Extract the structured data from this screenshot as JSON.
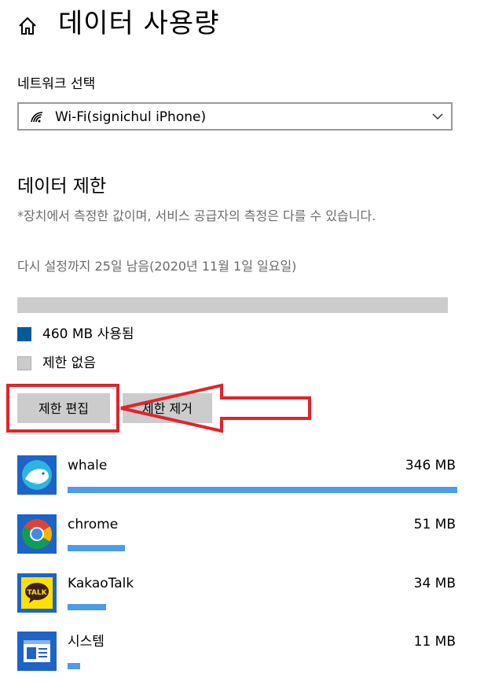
{
  "header": {
    "title": "데이터 사용량",
    "home_icon": "home-icon"
  },
  "network": {
    "label": "네트워크 선택",
    "selected": "Wi-Fi(signichul iPhone)",
    "icon": "wifi-icon"
  },
  "data_limit": {
    "title": "데이터 제한",
    "note": "*장치에서 측정한 값이며, 서비스 공급자의 측정은 다를 수 있습니다.",
    "reset_text": "다시 설정까지 25일 남음(2020년 11월 1일 일요일)",
    "used_fraction": 0.0,
    "legend": [
      {
        "label": "460 MB 사용됨",
        "color": "#005a9e"
      },
      {
        "label": "제한 없음",
        "color": "#cccccc"
      }
    ]
  },
  "buttons": {
    "edit_limit": "제한 편집",
    "remove_limit": "제한 제거"
  },
  "apps": [
    {
      "name": "whale",
      "usage": "346 MB",
      "usage_mb": 346,
      "icon": "whale-icon"
    },
    {
      "name": "chrome",
      "usage": "51 MB",
      "usage_mb": 51,
      "icon": "chrome-icon"
    },
    {
      "name": "KakaoTalk",
      "usage": "34 MB",
      "usage_mb": 34,
      "icon": "kakaotalk-icon"
    },
    {
      "name": "시스템",
      "usage": "11 MB",
      "usage_mb": 11,
      "icon": "system-icon"
    }
  ],
  "colors": {
    "accent": "#005a9e",
    "app_bar": "#4a9de6",
    "annotation": "#e0242c"
  }
}
